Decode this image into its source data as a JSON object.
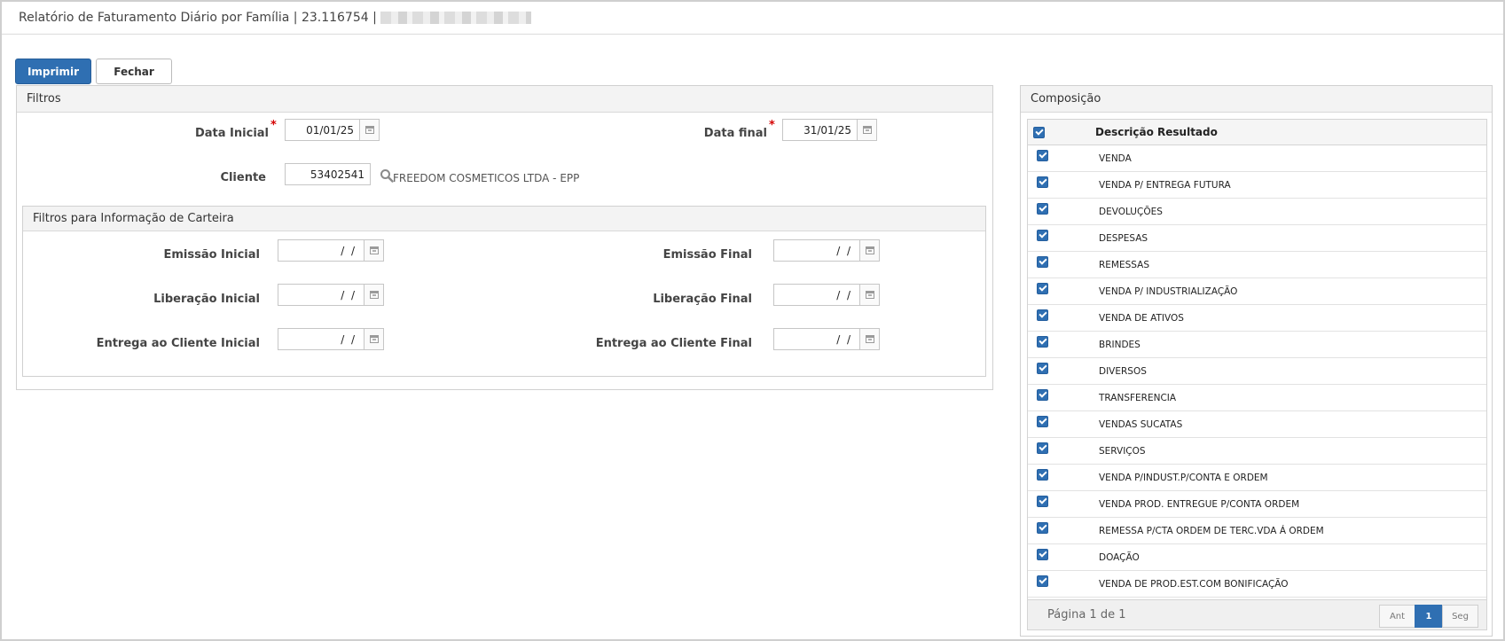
{
  "window": {
    "title": "Relatório de Faturamento Diário por Família | 23.116754 |"
  },
  "toolbar": {
    "print_label": "Imprimir",
    "close_label": "Fechar"
  },
  "filters": {
    "title": "Filtros",
    "data_inicial_label": "Data Inicial",
    "data_inicial_value": "01/01/25",
    "data_final_label": "Data final",
    "data_final_value": "31/01/25",
    "required_mark": "*",
    "cliente_label": "Cliente",
    "cliente_value": "53402541",
    "cliente_name": "FREEDOM COSMETICOS LTDA - EPP"
  },
  "carteira": {
    "title": "Filtros para Informação de Carteira",
    "emissao_inicial_label": "Emissão Inicial",
    "emissao_inicial_value": " /  /",
    "emissao_final_label": "Emissão Final",
    "emissao_final_value": " /  /",
    "liberacao_inicial_label": "Liberação Inicial",
    "liberacao_inicial_value": " /  /",
    "liberacao_final_label": "Liberação Final",
    "liberacao_final_value": " /  /",
    "entrega_inicial_label": "Entrega ao Cliente Inicial",
    "entrega_inicial_value": " /  /",
    "entrega_final_label": "Entrega ao Cliente Final",
    "entrega_final_value": " /  /"
  },
  "composicao": {
    "title": "Composição",
    "column_header": "Descrição Resultado",
    "rows": [
      "VENDA",
      "VENDA P/ ENTREGA FUTURA",
      "DEVOLUÇÕES",
      "DESPESAS",
      "REMESSAS",
      "VENDA P/ INDUSTRIALIZAÇÃO",
      "VENDA DE ATIVOS",
      "BRINDES",
      "DIVERSOS",
      "TRANSFERENCIA",
      "VENDAS SUCATAS",
      "SERVIÇOS",
      "VENDA P/INDUST.P/CONTA E ORDEM",
      "VENDA PROD. ENTREGUE P/CONTA ORDEM",
      "REMESSA P/CTA ORDEM DE TERC.VDA Á ORDEM",
      "DOAÇÃO",
      "VENDA DE PROD.EST.COM BONIFICAÇÃO"
    ],
    "pager_info": "Página 1 de 1",
    "prev_label": "Ant",
    "page_label": "1",
    "next_label": "Seg"
  },
  "colors": {
    "primary": "#2f6fb2",
    "required": "#d40000"
  },
  "icons": {
    "calendar": "calendar-icon",
    "search": "search-icon",
    "checkbox": "checkbox-checked-icon"
  }
}
